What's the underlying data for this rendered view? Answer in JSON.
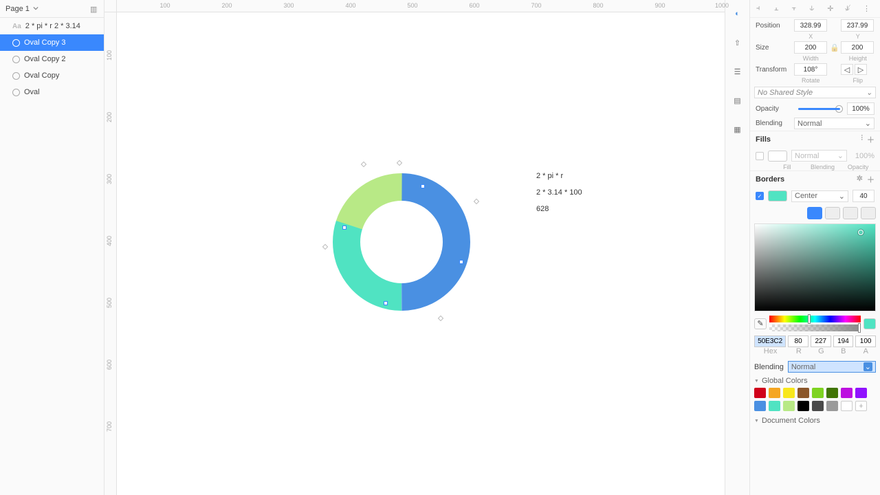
{
  "page_selector": "Page 1",
  "layers": [
    {
      "type": "text",
      "name": "2 * pi * r 2 * 3.14"
    },
    {
      "type": "oval",
      "name": "Oval Copy 3",
      "selected": true
    },
    {
      "type": "oval",
      "name": "Oval Copy 2"
    },
    {
      "type": "oval",
      "name": "Oval Copy"
    },
    {
      "type": "oval",
      "name": "Oval"
    }
  ],
  "ruler_h": [
    "100",
    "200",
    "300",
    "400",
    "500",
    "600",
    "700",
    "800",
    "900",
    "1000"
  ],
  "ruler_v": [
    "100",
    "200",
    "300",
    "400",
    "500",
    "600",
    "700"
  ],
  "canvas_text": {
    "line1": "2 * pi * r",
    "line2": "2 * 3.14 * 100",
    "line3": "628"
  },
  "inspector": {
    "position": {
      "x": "328.99",
      "y": "237.99",
      "xlabel": "X",
      "ylabel": "Y",
      "label": "Position"
    },
    "size": {
      "w": "200",
      "h": "200",
      "wlabel": "Width",
      "hlabel": "Height",
      "label": "Size"
    },
    "transform": {
      "rotate": "108°",
      "label": "Transform",
      "rlabel": "Rotate",
      "fliplabel": "Flip"
    },
    "no_style": "No Shared Style",
    "opacity": {
      "label": "Opacity",
      "value": "100%"
    },
    "blending": {
      "label": "Blending",
      "value": "Normal"
    },
    "fills": {
      "title": "Fills",
      "fill_label": "Fill",
      "blend_label": "Blending",
      "blend_value": "Normal",
      "opacity_label": "Opacity",
      "opacity_value": "100%"
    },
    "borders": {
      "title": "Borders",
      "position": "Center",
      "thickness": "40",
      "swatch": "#50E3C2"
    }
  },
  "picker": {
    "hex": "50E3C2",
    "r": "80",
    "g": "227",
    "b": "194",
    "a": "100",
    "hex_l": "Hex",
    "r_l": "R",
    "g_l": "G",
    "b_l": "B",
    "a_l": "A",
    "blending_label": "Blending",
    "blending": "Normal",
    "global_label": "Global Colors",
    "doc_label": "Document Colors",
    "swatches": [
      "#d0021b",
      "#f5a623",
      "#f8e71c",
      "#8b572a",
      "#7ed321",
      "#417505",
      "#bd10e0",
      "#9013fe",
      "#4a90e2",
      "#50e3c2",
      "#b8e986",
      "#000000",
      "#4a4a4a",
      "#9b9b9b",
      "#ffffff"
    ]
  }
}
